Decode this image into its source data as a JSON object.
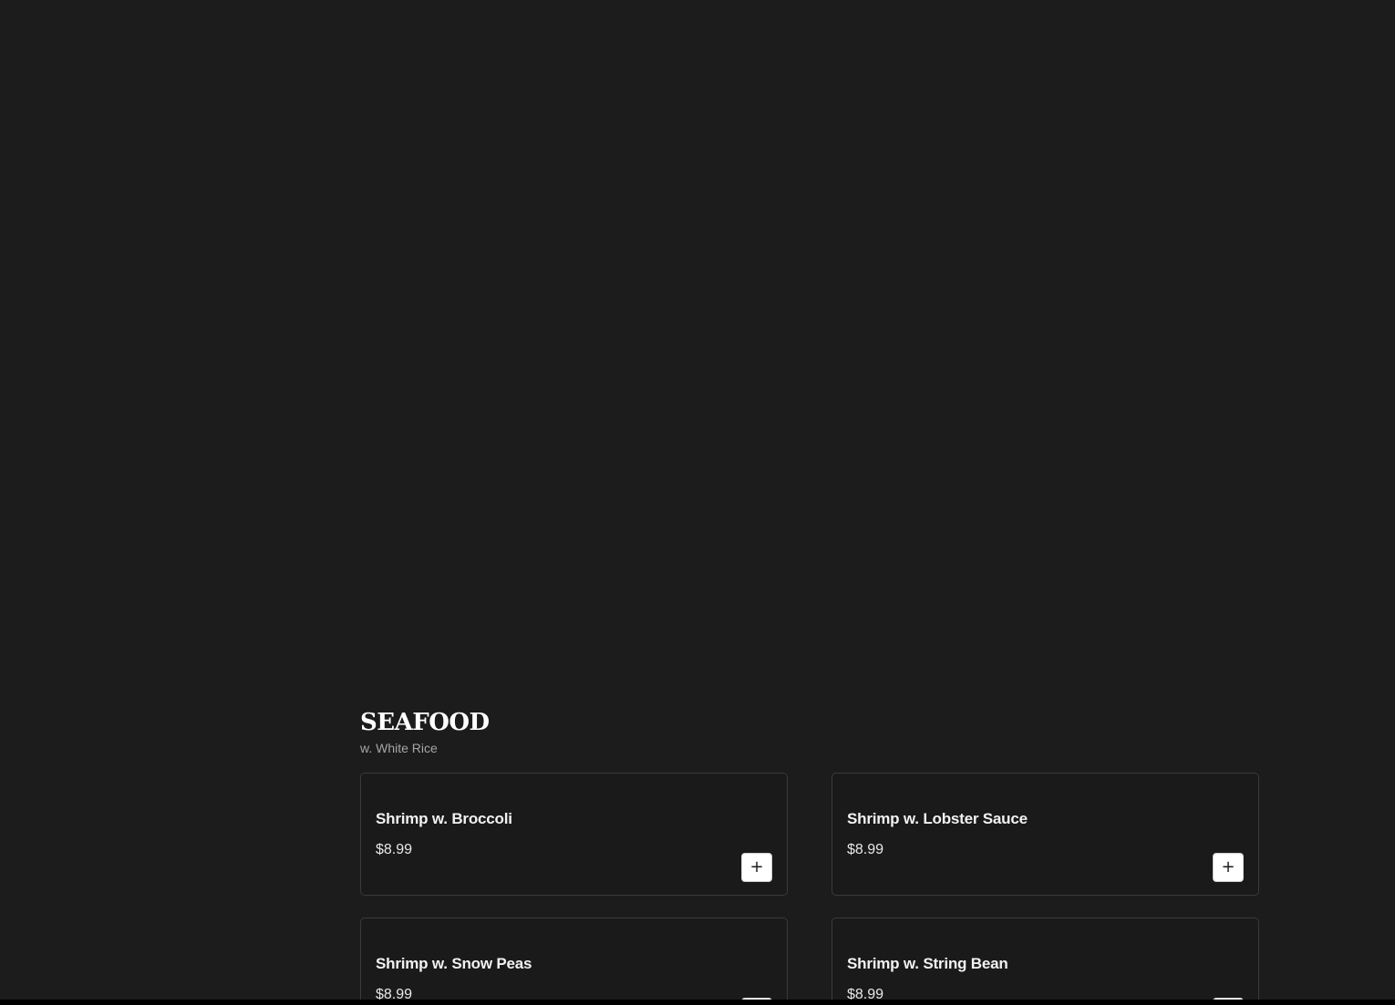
{
  "menu": {
    "section": {
      "title": "SEAFOOD",
      "subtitle": "w. White Rice",
      "items": [
        {
          "name": "Shrimp w. Broccoli",
          "price": "$8.99",
          "add_label": "+"
        },
        {
          "name": "Shrimp w. Lobster Sauce",
          "price": "$8.99",
          "add_label": "+"
        },
        {
          "name": "Shrimp w. Snow Peas",
          "price": "$8.99",
          "add_label": "+"
        },
        {
          "name": "Shrimp w. String Bean",
          "price": "$8.99",
          "add_label": "+"
        }
      ]
    }
  },
  "icons": {
    "add": "plus-icon"
  },
  "colors": {
    "background": "#1c1c1c",
    "card_border": "#3a3a3a",
    "subtitle": "#a6a6a6",
    "button_bg": "#ffffff"
  }
}
